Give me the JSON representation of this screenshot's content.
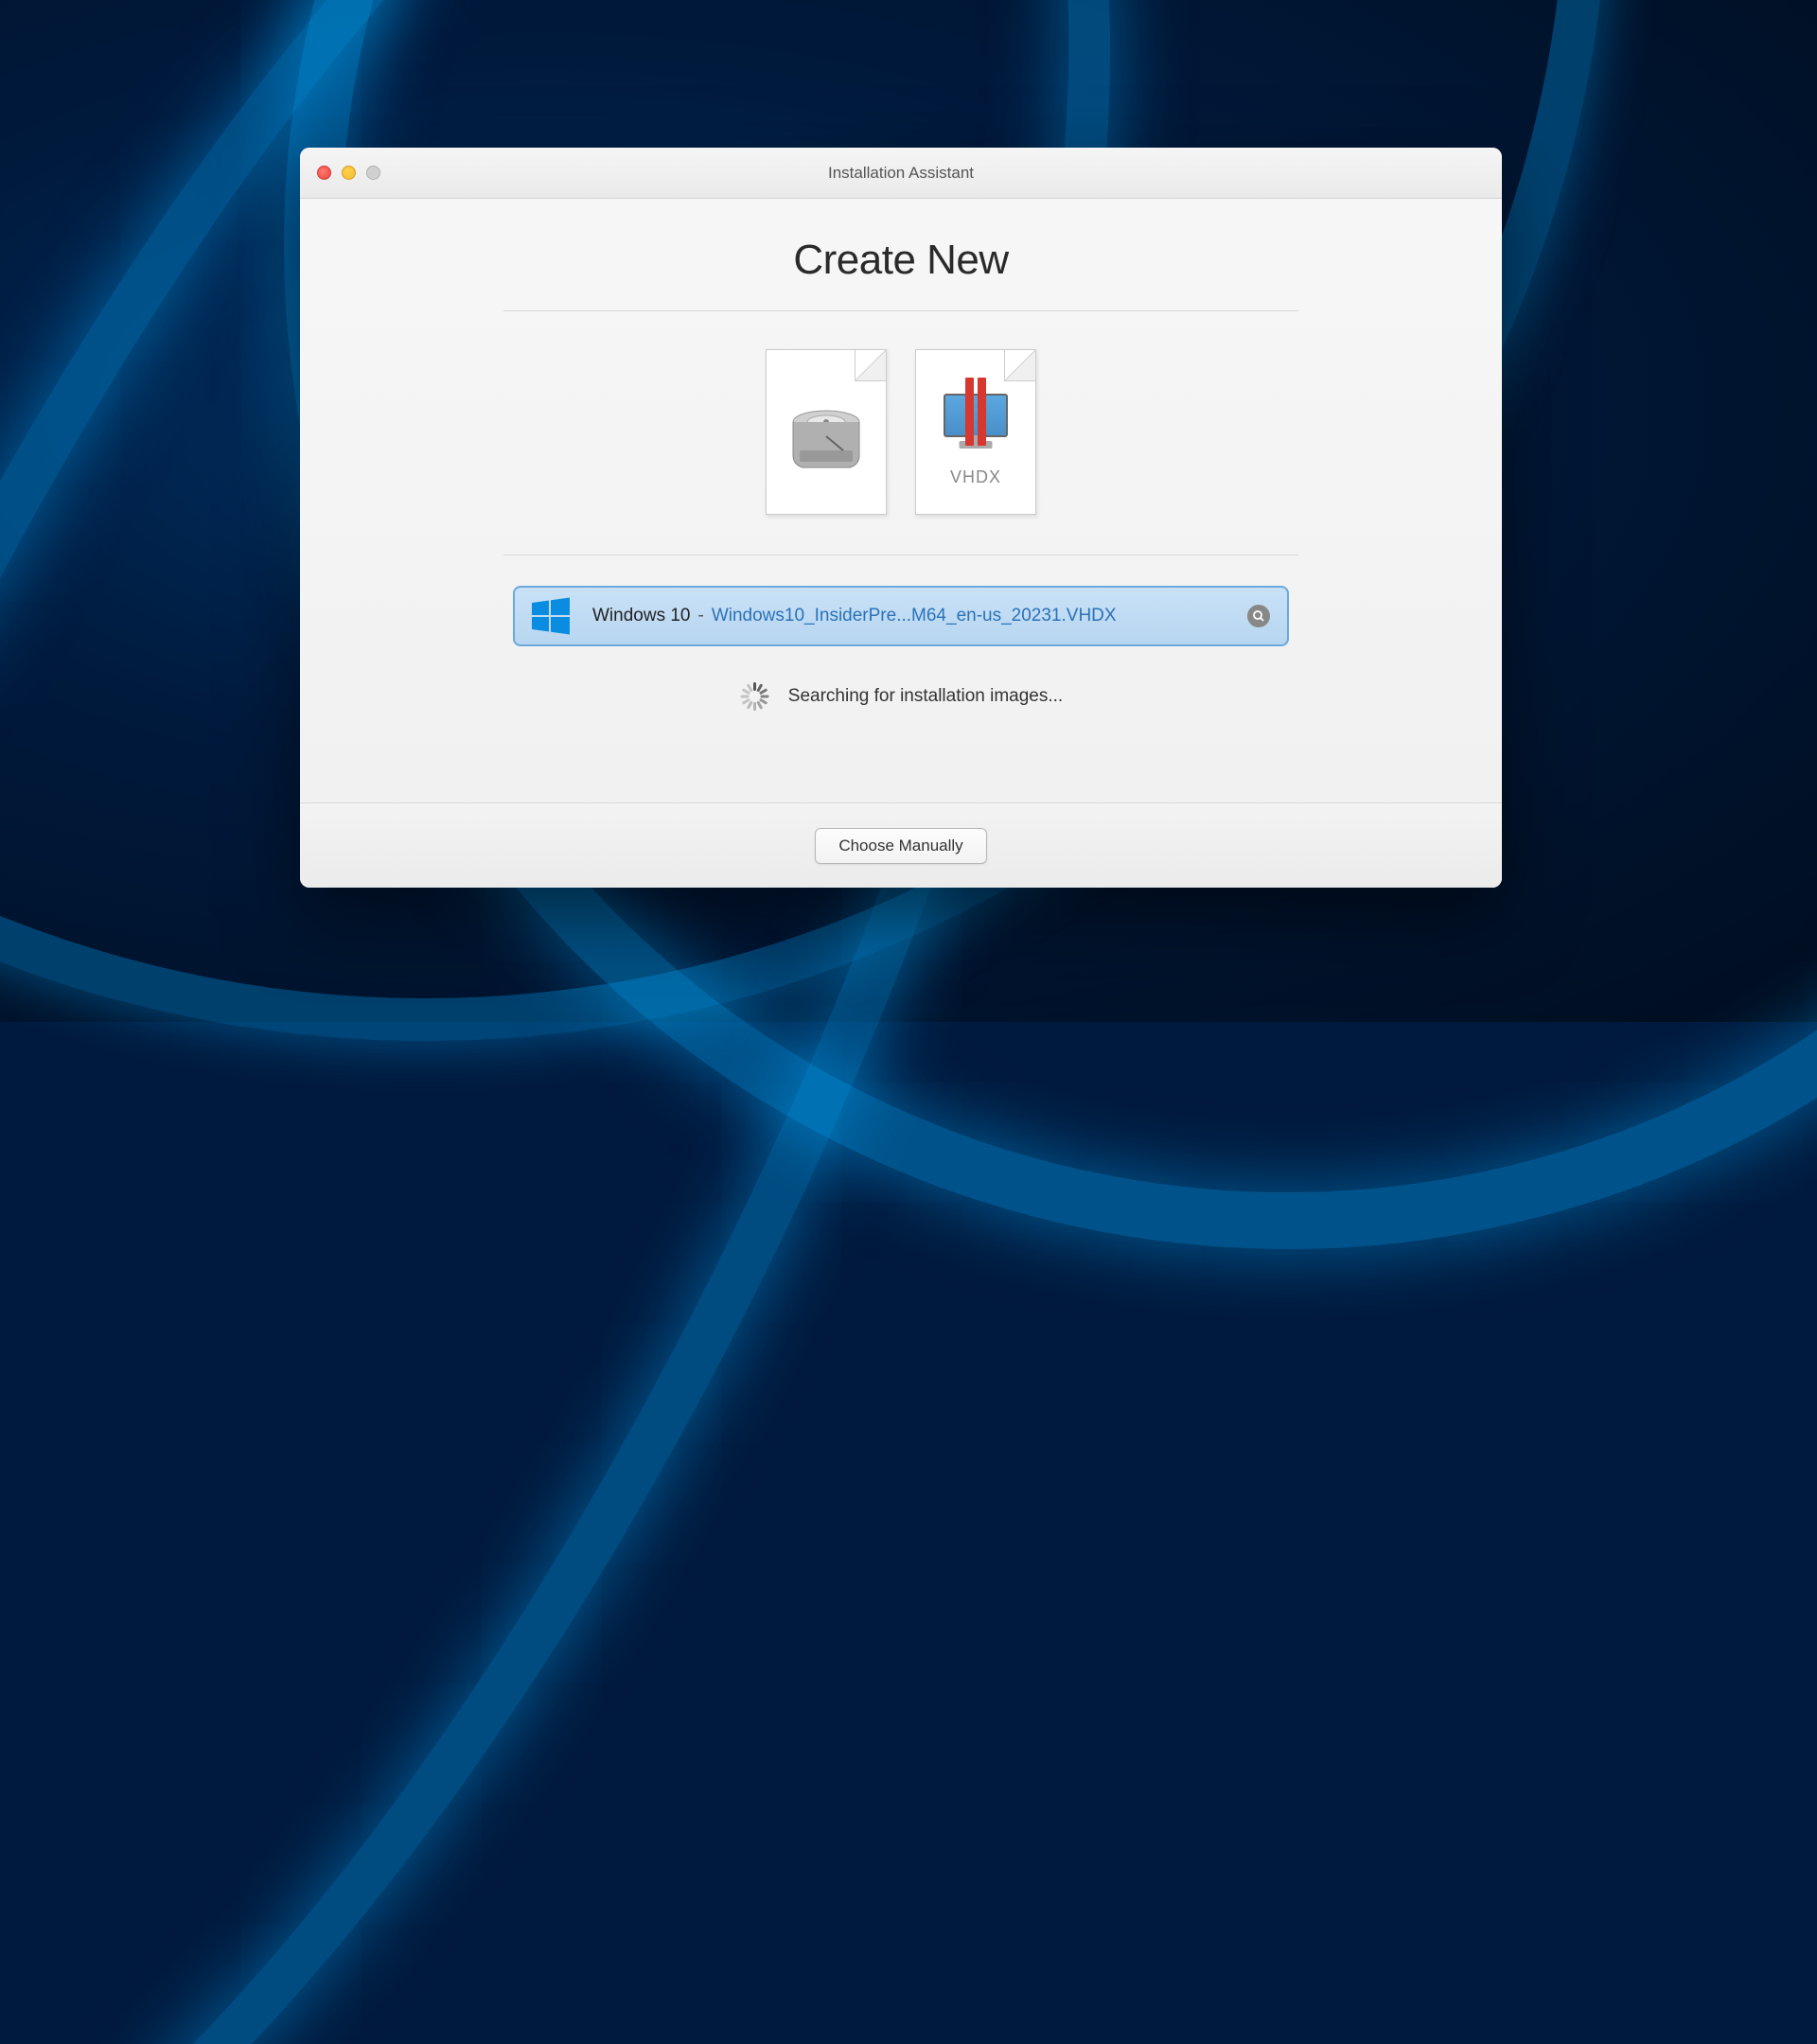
{
  "window": {
    "title": "Installation Assistant"
  },
  "heading": "Create New",
  "icons": {
    "vhdx_label": "VHDX"
  },
  "found_item": {
    "os_name": "Windows 10",
    "separator": "-",
    "filename": "Windows10_InsiderPre...M64_en-us_20231.VHDX"
  },
  "status": {
    "text": "Searching for installation images..."
  },
  "buttons": {
    "choose_manually": "Choose Manually"
  }
}
